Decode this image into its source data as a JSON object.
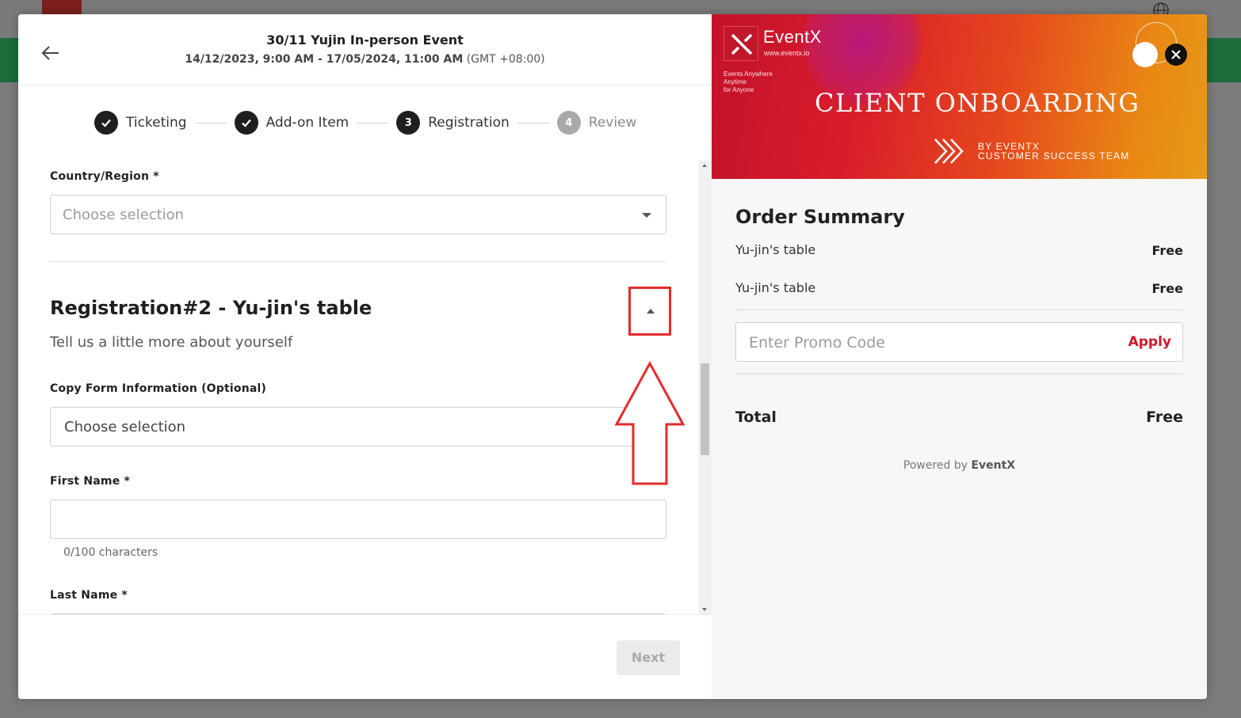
{
  "event": {
    "title": "30/11 Yujin In-person Event",
    "date_range": "14/12/2023, 9:00 AM - 17/05/2024, 11:00 AM",
    "timezone": "(GMT +08:00)"
  },
  "steps": [
    {
      "label": "Ticketing",
      "status": "done"
    },
    {
      "label": "Add-on Item",
      "status": "done"
    },
    {
      "number": "3",
      "label": "Registration",
      "status": "current"
    },
    {
      "number": "4",
      "label": "Review",
      "status": "upcoming"
    }
  ],
  "form": {
    "country": {
      "label": "Country/Region *",
      "placeholder": "Choose selection"
    },
    "registration_title": "Registration#2 - Yu-jin's table",
    "registration_subtitle": "Tell us a little more about yourself",
    "copy_form": {
      "label": "Copy Form Information (Optional)",
      "placeholder": "Choose selection"
    },
    "first_name": {
      "label": "First Name *",
      "value": "",
      "helper": "0/100 characters"
    },
    "last_name": {
      "label": "Last Name *"
    }
  },
  "footer": {
    "next_label": "Next"
  },
  "banner": {
    "brand": "EventX",
    "url": "www.eventx.io",
    "tagline_1": "Events Anywhere",
    "tagline_2": "Anytime",
    "tagline_3": "for Anyone",
    "title": "CLIENT ONBOARDING",
    "by_line_1": "BY EVENTX",
    "by_line_2": "CUSTOMER SUCCESS TEAM"
  },
  "summary": {
    "title": "Order Summary",
    "items": [
      {
        "name": "Yu-jin's table",
        "price": "Free"
      },
      {
        "name": "Yu-jin's table",
        "price": "Free"
      }
    ],
    "promo_placeholder": "Enter Promo Code",
    "apply_label": "Apply",
    "total_label": "Total",
    "total_value": "Free",
    "powered_prefix": "Powered by",
    "powered_brand": "EventX"
  },
  "colors": {
    "accent_red": "#d1172b",
    "annotation_red": "#e32b2b",
    "step_active": "#1f1f1f",
    "step_upcoming": "#a9a9a9"
  },
  "icons": [
    "back-arrow-icon",
    "check-icon",
    "chevron-down-icon",
    "chevron-up-icon",
    "close-icon",
    "globe-icon",
    "eventx-logo-icon",
    "chevrons-right-icon",
    "up-arrow-annotation-icon"
  ]
}
